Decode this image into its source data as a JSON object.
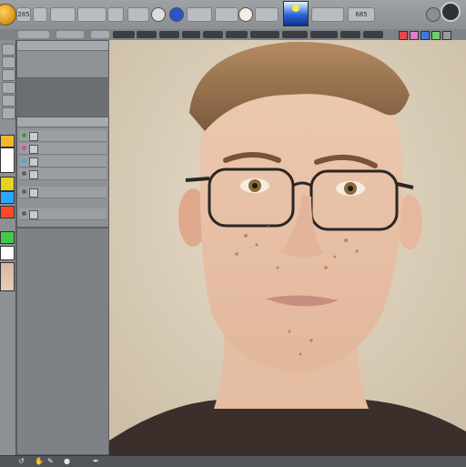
{
  "menubar": {
    "items": [
      "285",
      "",
      "",
      "",
      "",
      "",
      "",
      "",
      "",
      "",
      "685"
    ],
    "accent_color": "#f2b330",
    "swatch_color": "#2a66d8"
  },
  "optionbar": {
    "items": [
      "",
      "",
      "",
      "",
      "",
      "",
      "",
      "",
      "",
      "",
      "",
      "",
      "",
      ""
    ],
    "chips": [
      "#e24a4a",
      "#e07ad0",
      "#3f78e0",
      "#6bd06b",
      "#9a9aa0"
    ]
  },
  "toolstrip": {
    "colors": [
      "#f4b72a",
      "#ffffff",
      "#e8d020",
      "#2aa8ff",
      "#ff4a2a",
      "#42c84a",
      "#ffffff"
    ]
  },
  "panels": {
    "properties_title": "",
    "layers_title": "",
    "layers": [
      {
        "label": ""
      },
      {
        "label": ""
      },
      {
        "label": ""
      },
      {
        "label": ""
      },
      {
        "label": ""
      },
      {
        "label": ""
      }
    ]
  },
  "canvas": {
    "subject": "portrait-photo",
    "background_color": "#ddd4c3"
  },
  "statusbar": {
    "icons": [
      "undo-icon",
      "hand-icon",
      "brush-icon",
      "eyedropper-icon",
      "pen-icon"
    ]
  }
}
